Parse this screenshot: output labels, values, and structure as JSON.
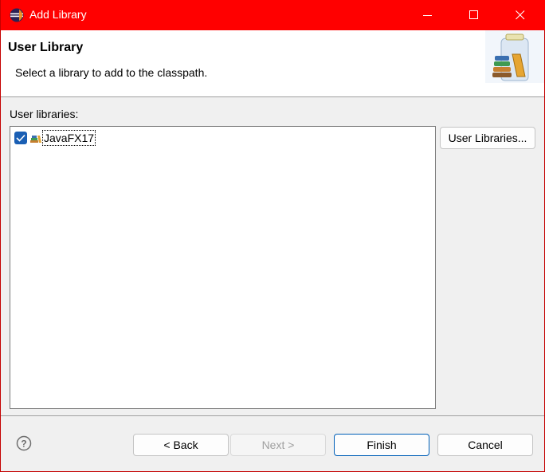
{
  "window": {
    "title": "Add Library"
  },
  "banner": {
    "title": "User Library",
    "description": "Select a library to add to the classpath."
  },
  "libraries": {
    "label": "User libraries:",
    "items": [
      {
        "name": "JavaFX17",
        "checked": true
      }
    ],
    "manage_button": "User Libraries..."
  },
  "footer": {
    "back": "< Back",
    "next": "Next >",
    "finish": "Finish",
    "cancel": "Cancel"
  },
  "colors": {
    "titlebar": "#ff0000",
    "accent": "#1a5fb4"
  }
}
